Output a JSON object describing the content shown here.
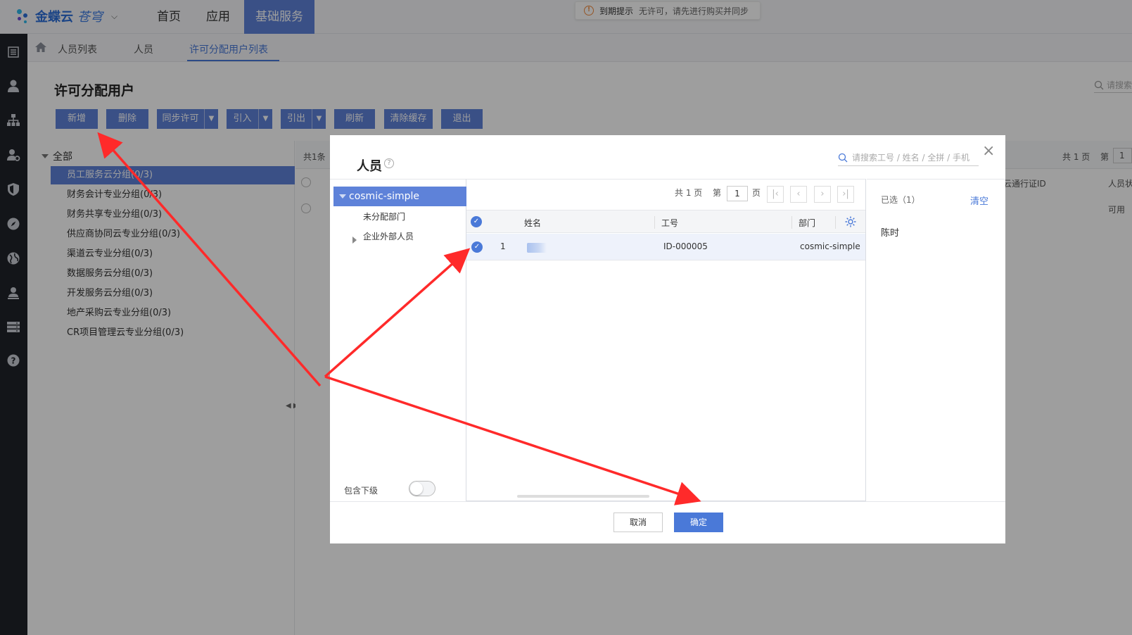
{
  "app": {
    "brand": "金蝶云",
    "brand_sub": "苍穹",
    "nav": [
      {
        "label": "首页"
      },
      {
        "label": "应用"
      },
      {
        "label": "基础服务"
      }
    ],
    "notice_title": "到期提示",
    "notice_text": "无许可，请先进行购买并同步"
  },
  "breadcrumbs": [
    {
      "label": "人员列表"
    },
    {
      "label": "人员"
    },
    {
      "label": "许可分配用户列表"
    }
  ],
  "page": {
    "title": "许可分配用户",
    "search_placeholder": "请搜索"
  },
  "toolbar": [
    {
      "label": "新增"
    },
    {
      "label": "删除"
    },
    {
      "label": "同步许可"
    },
    {
      "label": "引入"
    },
    {
      "label": "引出"
    },
    {
      "label": "刷新"
    },
    {
      "label": "清除缓存"
    },
    {
      "label": "退出"
    }
  ],
  "tree": {
    "root": "全部",
    "items": [
      "员工服务云分组(0/3)",
      "财务会计专业分组(0/3)",
      "财务共享专业分组(0/3)",
      "供应商协同云专业分组(0/3)",
      "渠道云专业分组(0/3)",
      "数据服务云分组(0/3)",
      "开发服务云分组(0/3)",
      "地产采购云专业分组(0/3)",
      "CR项目管理云专业分组(0/3)"
    ]
  },
  "background_grid": {
    "count_text": "共1条",
    "pages_text": "共 1 页",
    "page_label": "第",
    "page_value": "1",
    "col_passport": "云通行证ID",
    "col_status": "人员状",
    "row_status": "可用"
  },
  "modal": {
    "title": "人员",
    "search_placeholder": "请搜索工号 / 姓名 / 全拼 / 手机",
    "tree_root": "cosmic-simple",
    "tree_nodes": [
      "未分配部门",
      "企业外部人员"
    ],
    "include_sub_label": "包含下级",
    "pager": {
      "total": "共 1 页",
      "page_prefix": "第",
      "page_value": "1",
      "page_suffix": "页"
    },
    "columns": {
      "name": "姓名",
      "code": "工号",
      "dept": "部门"
    },
    "rows": [
      {
        "index": "1",
        "code": "ID-000005",
        "dept": "cosmic-simple"
      }
    ],
    "selected_title": "已选（1）",
    "clear_label": "清空",
    "selected_items": [
      "陈时"
    ],
    "cancel_label": "取消",
    "ok_label": "确定"
  },
  "colors": {
    "accent": "#5e82d9",
    "primary": "#4a79d8",
    "sidebar": "#1f2329",
    "annotation_arrow": "#ff2a2a"
  }
}
